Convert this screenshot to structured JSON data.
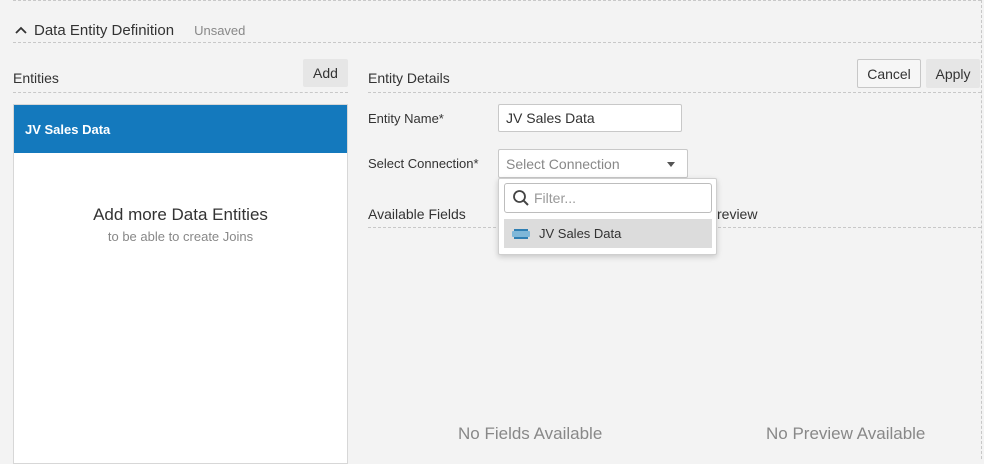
{
  "section": {
    "title": "Data Entity Definition",
    "status": "Unsaved"
  },
  "entities": {
    "heading": "Entities",
    "add_label": "Add",
    "items": [
      {
        "label": "JV Sales Data"
      }
    ],
    "empty_title": "Add more Data Entities",
    "empty_subtitle": "to be able to create Joins"
  },
  "details": {
    "heading": "Entity Details",
    "cancel_label": "Cancel",
    "apply_label": "Apply",
    "name_label": "Entity Name*",
    "name_value": "JV Sales Data",
    "connection_label": "Select Connection*",
    "connection_placeholder": "Select Connection",
    "dropdown": {
      "filter_placeholder": "Filter...",
      "options": [
        {
          "label": "JV Sales Data",
          "icon": "database-icon"
        }
      ]
    },
    "fields_heading": "Available Fields",
    "preview_heading_partial": "review",
    "no_fields": "No Fields Available",
    "no_preview": "No Preview Available"
  },
  "colors": {
    "selected_bg": "#1479bd",
    "background": "#f3f3f3",
    "option_hover": "#dcdcdc"
  }
}
